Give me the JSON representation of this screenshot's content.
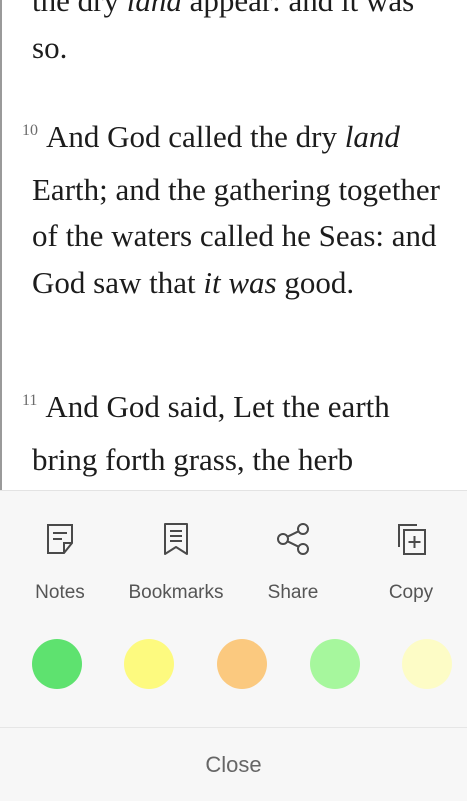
{
  "reader": {
    "top_fragment": {
      "text_a": "the dry ",
      "italic_a": "land",
      "text_b": " appear: and it was",
      "line2": "so."
    },
    "verse10": {
      "number": "10",
      "text_a": "And God called the dry ",
      "italic_a": "land",
      "text_b": " Earth; and the gathering together of the waters called he Seas: and God saw that ",
      "italic_b": "it was",
      "text_c": " good."
    },
    "verse11": {
      "number": "11",
      "text": "And God said, Let the earth bring forth grass, the herb"
    }
  },
  "sheet": {
    "actions": [
      {
        "label": "Notes",
        "icon": "notes-icon"
      },
      {
        "label": "Bookmarks",
        "icon": "bookmarks-icon"
      },
      {
        "label": "Share",
        "icon": "share-icon"
      },
      {
        "label": "Copy",
        "icon": "copy-icon"
      }
    ],
    "highlight_colors": [
      "#5ee26f",
      "#fdfa7f",
      "#fbc97f",
      "#a6f79d",
      "#fdfcc6"
    ],
    "close_label": "Close"
  }
}
